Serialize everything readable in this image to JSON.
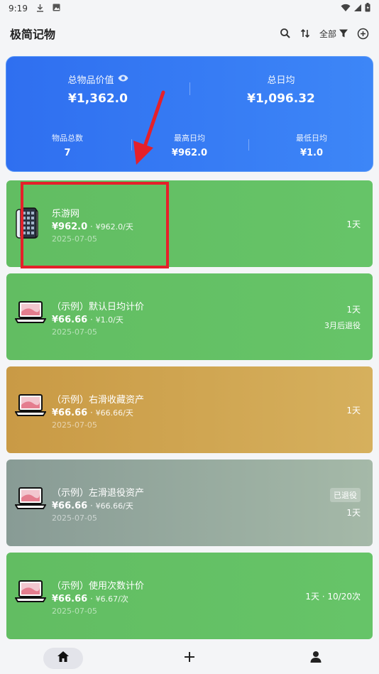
{
  "status_bar": {
    "time": "9:19"
  },
  "app_bar": {
    "title": "极简记物",
    "filter_label": "全部"
  },
  "summary": {
    "total_value_label": "总物品价值",
    "total_value": "¥1,362.0",
    "total_daily_label": "总日均",
    "total_daily": "¥1,096.32",
    "count_label": "物品总数",
    "count": "7",
    "max_daily_label": "最高日均",
    "max_daily": "¥962.0",
    "min_daily_label": "最低日均",
    "min_daily": "¥1.0"
  },
  "items": [
    {
      "name": "乐游网",
      "price": "¥962.0",
      "rate": "¥962.0/天",
      "date": "2025-07-05",
      "right": "1天",
      "sub": "",
      "badge": "",
      "color": "#62bd62",
      "icon": "phone-icon"
    },
    {
      "name": "（示例）默认日均计价",
      "price": "¥66.66",
      "rate": "¥1.0/天",
      "date": "2025-07-05",
      "right": "1天",
      "sub": "3月后退役",
      "badge": "",
      "color": "#62bd62",
      "icon": "laptop-icon"
    },
    {
      "name": "（示例）右滑收藏资产",
      "price": "¥66.66",
      "rate": "¥66.66/天",
      "date": "2025-07-05",
      "right": "1天",
      "sub": "",
      "badge": "",
      "color": "#c99a45",
      "icon": "laptop-icon"
    },
    {
      "name": "（示例）左滑退役资产",
      "price": "¥66.66",
      "rate": "¥66.66/天",
      "date": "2025-07-05",
      "right": "1天",
      "sub": "",
      "badge": "已退役",
      "color": "#889b95",
      "icon": "laptop-icon"
    },
    {
      "name": "（示例）使用次数计价",
      "price": "¥66.66",
      "rate": "¥6.67/次",
      "date": "2025-07-05",
      "right": "1天 · 10/20次",
      "sub": "",
      "badge": "",
      "color": "#62bd62",
      "icon": "laptop-icon"
    }
  ],
  "price_separator": "·",
  "colors": {
    "accent_blue": "#2f6ff0",
    "green": "#62bd62",
    "gold": "#c99a45",
    "grey": "#889b95",
    "highlight_red": "#e5202a"
  }
}
